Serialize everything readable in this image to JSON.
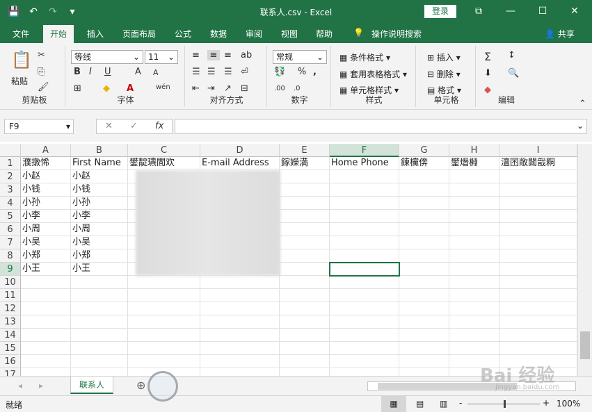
{
  "titlebar": {
    "title": "联系人.csv  -  Excel",
    "login": "登录",
    "save_icon": "💾",
    "undo_icon": "↶",
    "redo_icon": "↷",
    "customize_icon": "▾"
  },
  "tabs": [
    "文件",
    "开始",
    "插入",
    "页面布局",
    "公式",
    "数据",
    "审阅",
    "视图",
    "帮助",
    "操作说明搜索",
    "共享"
  ],
  "ribbon": {
    "clipboard": {
      "paste": "粘贴",
      "label": "剪贴板"
    },
    "font": {
      "name": "等线",
      "size": "11",
      "bold": "B",
      "italic": "I",
      "underline": "U",
      "grow": "A",
      "shrink": "A",
      "wen": "wén",
      "label": "字体"
    },
    "alignment": {
      "label": "对齐方式"
    },
    "number": {
      "format": "常规",
      "percent": "%",
      "comma": ",",
      "label": "数字"
    },
    "styles": {
      "conditional": "条件格式",
      "table": "套用表格格式",
      "cell": "单元格样式",
      "label": "样式"
    },
    "cells": {
      "insert": "插入",
      "delete": "删除",
      "format": "格式",
      "label": "单元格"
    },
    "editing": {
      "sigma": "Σ",
      "label": "编辑"
    }
  },
  "formula_bar": {
    "name_box": "F9",
    "fx": "fx",
    "cancel": "✕",
    "enter": "✓",
    "value": ""
  },
  "columns": [
    "A",
    "B",
    "C",
    "D",
    "E",
    "F",
    "G",
    "H",
    "I"
  ],
  "rows": [
    "1",
    "2",
    "3",
    "4",
    "5",
    "6",
    "7",
    "8",
    "9",
    "10",
    "11",
    "12",
    "13",
    "14",
    "15",
    "16",
    "17"
  ],
  "header_row": [
    "濮撴悕",
    "First Name",
    "鐢靛瓙閭欢",
    "E-mail Address",
    "鎵嬫満",
    "Home Phone",
    "鍊欓倴",
    "鐢熸棩",
    "澶囨敞閮戠粡"
  ],
  "colA": [
    "小赵",
    "小钱",
    "小孙",
    "小李",
    "小周",
    "小吴",
    "小郑",
    "小王"
  ],
  "colB": [
    "小赵",
    "小钱",
    "小孙",
    "小李",
    "小周",
    "小吴",
    "小郑",
    "小王"
  ],
  "sheet": {
    "tab": "联系人",
    "add": "⊕"
  },
  "status": {
    "ready": "就绪",
    "zoom": "100%",
    "minus": "-",
    "plus": "+"
  },
  "watermark": {
    "text": "Bai 经验",
    "url": "jingyan.baidu.com"
  }
}
